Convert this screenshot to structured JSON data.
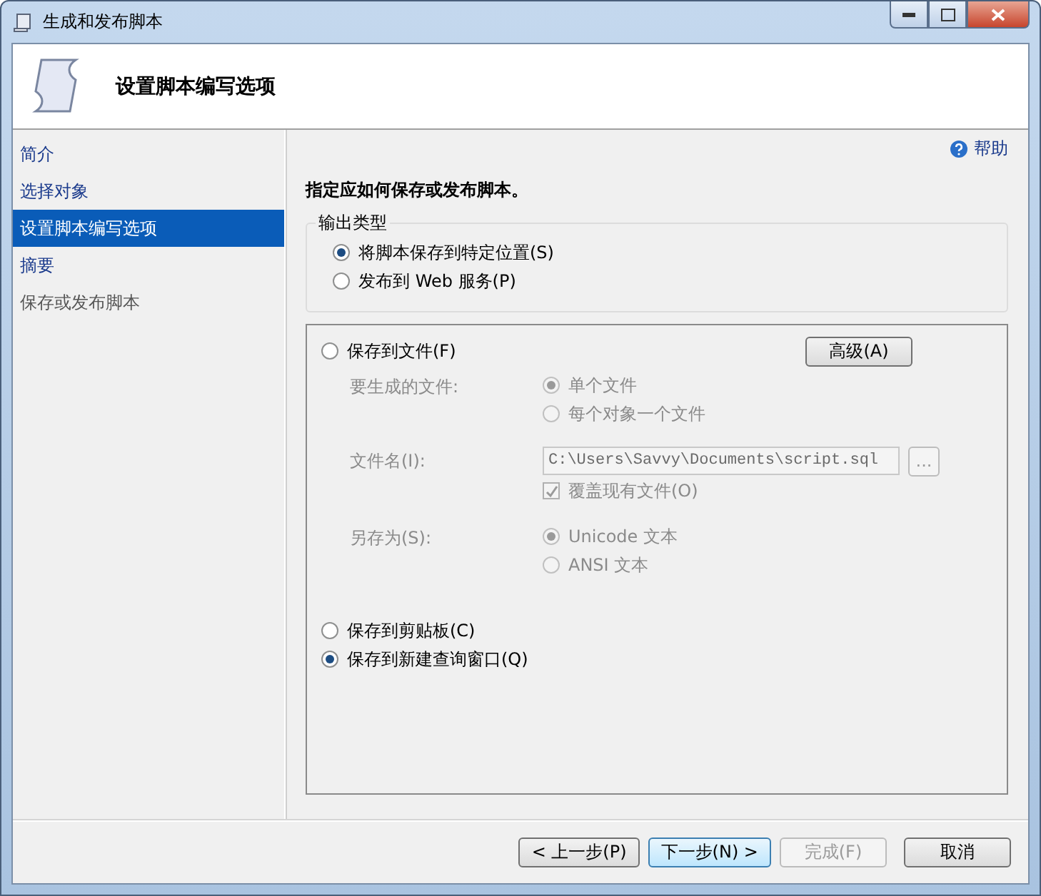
{
  "window": {
    "title": "生成和发布脚本"
  },
  "header": {
    "title": "设置脚本编写选项"
  },
  "sidebar": {
    "items": [
      {
        "label": "简介",
        "selected": false,
        "disabled": false
      },
      {
        "label": "选择对象",
        "selected": false,
        "disabled": false
      },
      {
        "label": "设置脚本编写选项",
        "selected": true,
        "disabled": false
      },
      {
        "label": "摘要",
        "selected": false,
        "disabled": false
      },
      {
        "label": "保存或发布脚本",
        "selected": false,
        "disabled": true
      }
    ]
  },
  "help": {
    "label": "帮助"
  },
  "instruction": "指定应如何保存或发布脚本。",
  "output_type": {
    "legend": "输出类型",
    "options": [
      {
        "label": "将脚本保存到特定位置(S)",
        "selected": true
      },
      {
        "label": "发布到 Web 服务(P)",
        "selected": false
      }
    ]
  },
  "destination": {
    "save_to_file": {
      "label": "保存到文件(F)",
      "selected": false
    },
    "advanced_button": "高级(A)",
    "file_options": {
      "disabled": true,
      "files_to_generate": {
        "label": "要生成的文件:",
        "options": [
          {
            "label": "单个文件",
            "selected": true
          },
          {
            "label": "每个对象一个文件",
            "selected": false
          }
        ]
      },
      "file_name": {
        "label": "文件名(I):",
        "value": "C:\\Users\\Savvy\\Documents\\script.sql",
        "browse": "..."
      },
      "overwrite": {
        "label": "覆盖现有文件(O)",
        "checked": true
      },
      "save_as": {
        "label": "另存为(S):",
        "options": [
          {
            "label": "Unicode 文本",
            "selected": true
          },
          {
            "label": "ANSI 文本",
            "selected": false
          }
        ]
      }
    },
    "clipboard": {
      "label": "保存到剪贴板(C)",
      "selected": false
    },
    "query_window": {
      "label": "保存到新建查询窗口(Q)",
      "selected": true
    }
  },
  "buttons": [
    {
      "label": "< 上一步(P)",
      "disabled": false,
      "focused": false
    },
    {
      "label": "下一步(N) >",
      "disabled": false,
      "focused": true
    },
    {
      "label": "完成(F)",
      "disabled": true,
      "focused": false
    },
    {
      "label": "取消",
      "disabled": false,
      "focused": false
    }
  ]
}
